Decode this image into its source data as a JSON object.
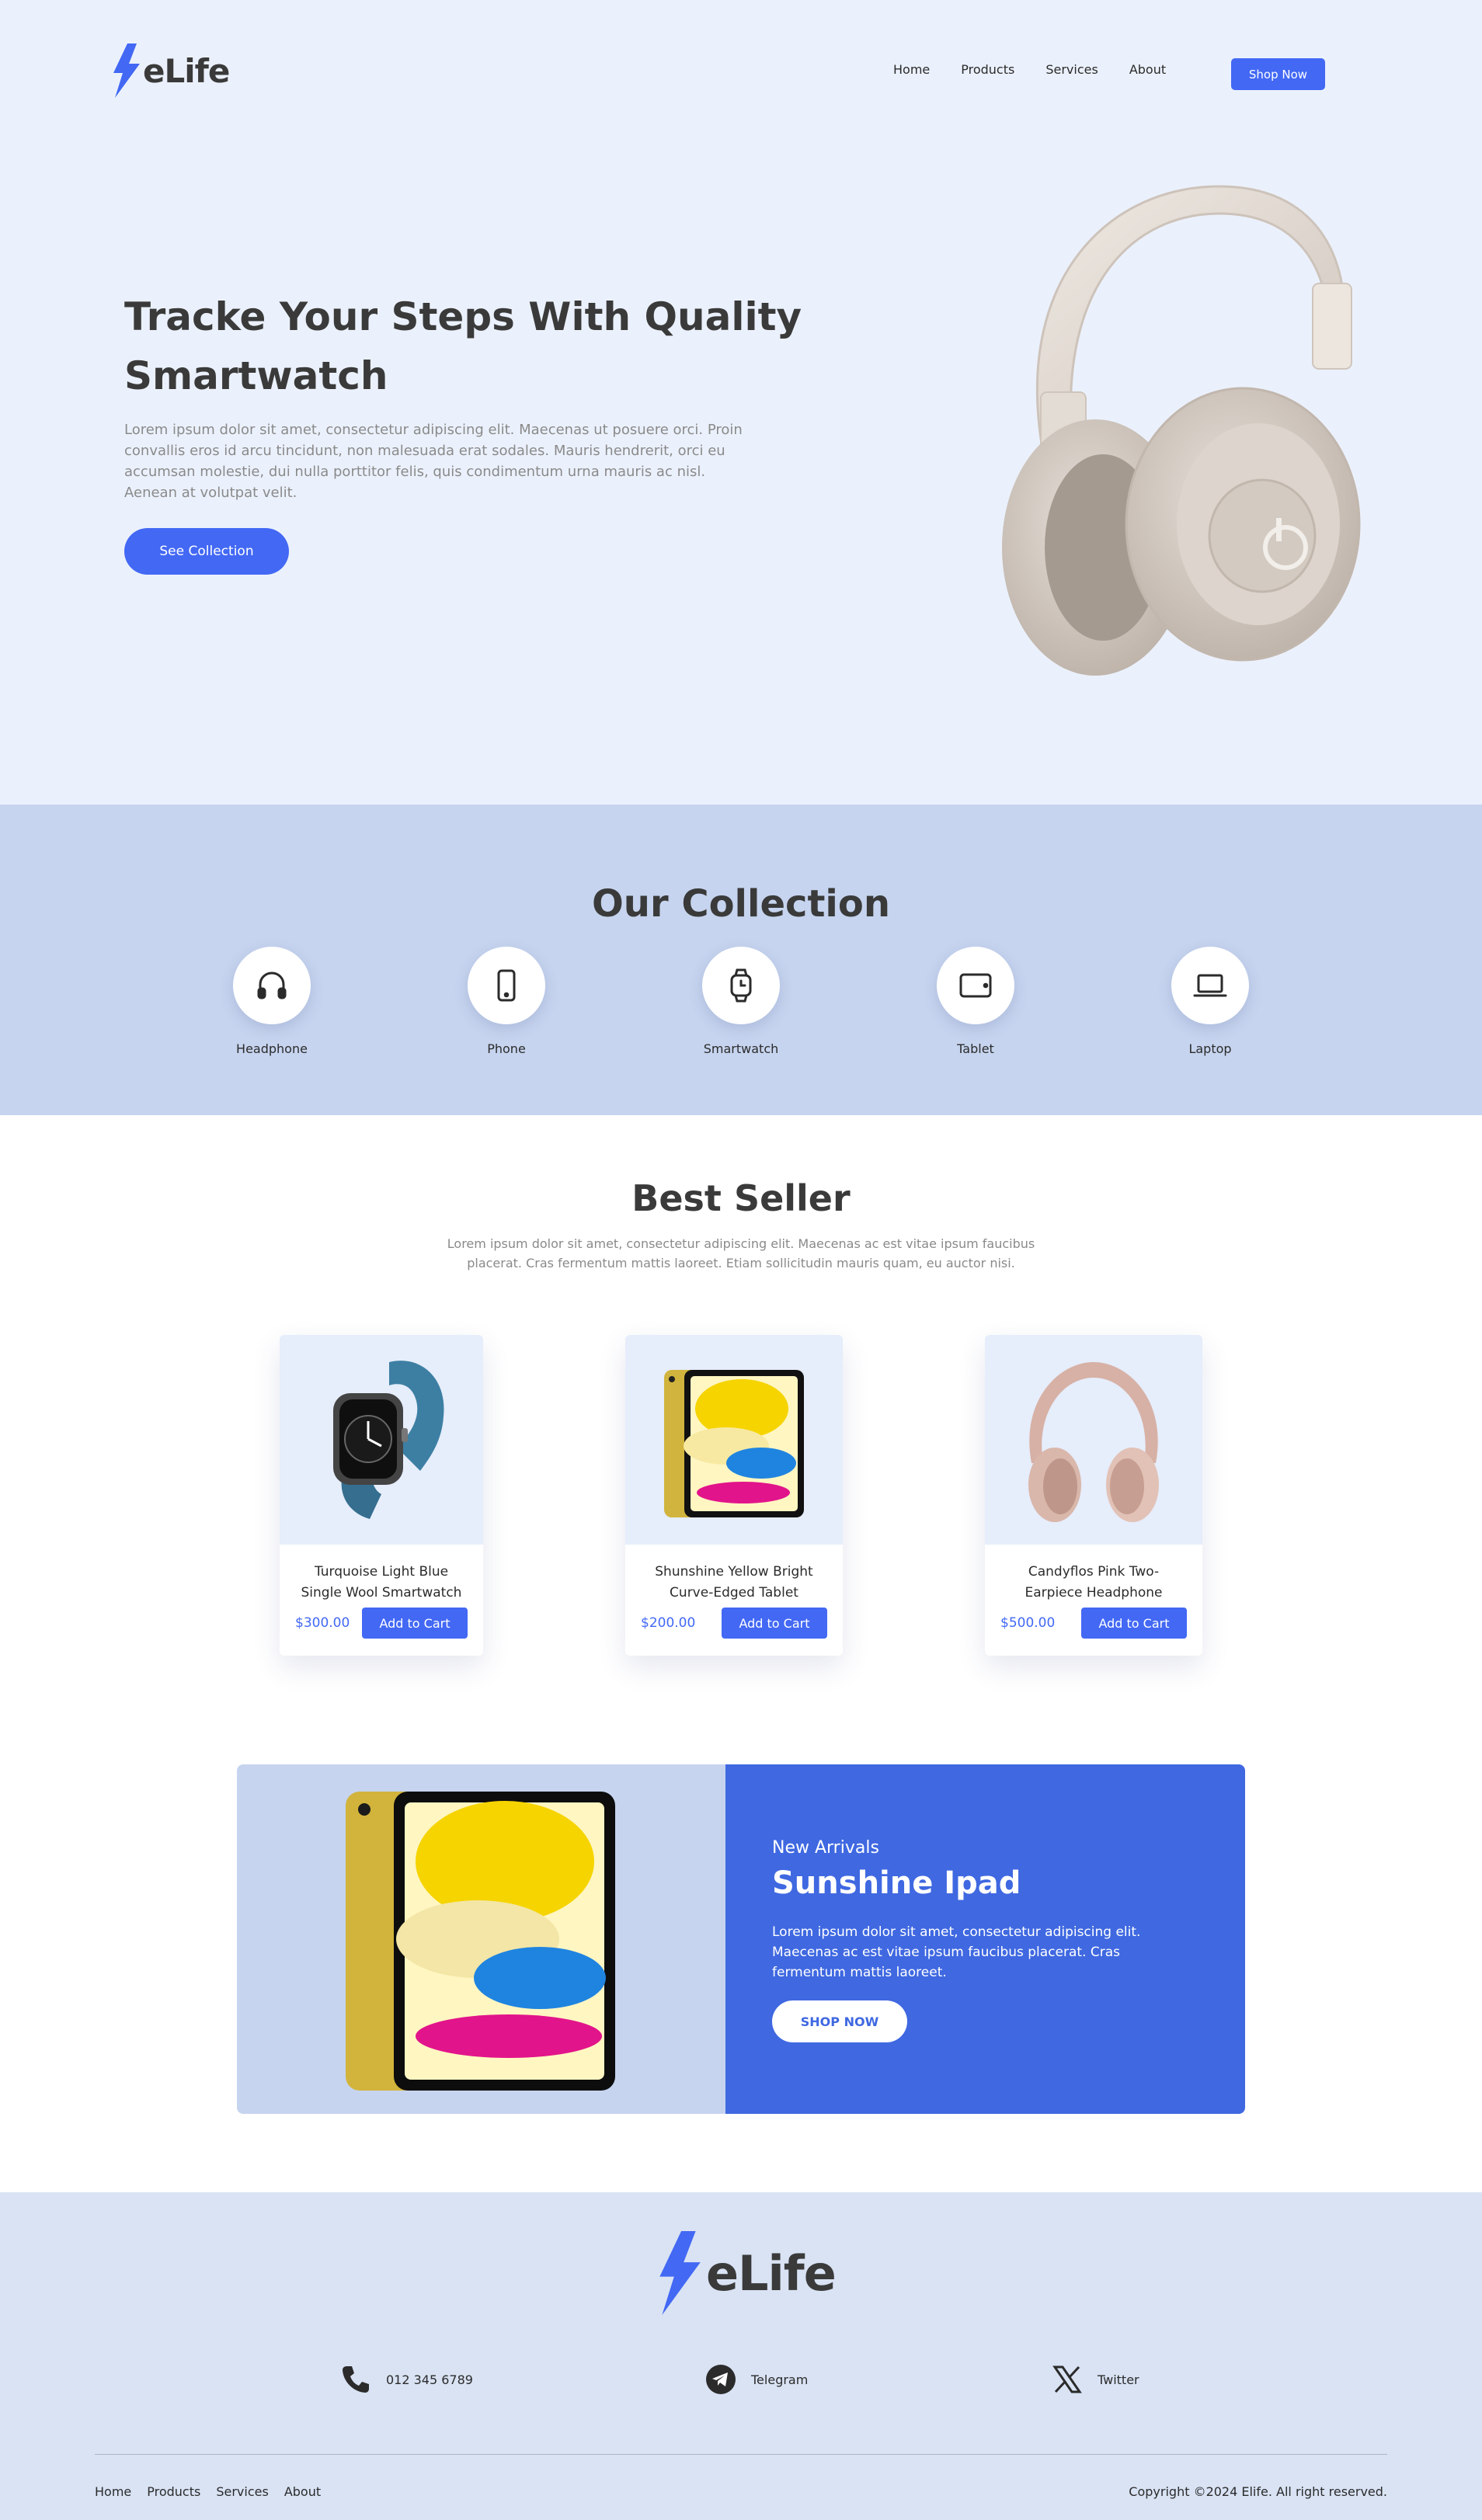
{
  "brand": {
    "name": "eLife",
    "accent": "#4268f4",
    "bolt_color": "#4268f4"
  },
  "header": {
    "nav": [
      "Home",
      "Products",
      "Services",
      "About"
    ],
    "cta": "Shop Now"
  },
  "hero": {
    "title_line1": "Tracke Your Steps With Quality",
    "title_line2": "Smartwatch",
    "desc_lines": [
      "Lorem ipsum dolor sit amet, consectetur adipiscing elit. Maecenas ut posuere orci. Proin",
      "convallis eros id arcu tincidunt, non malesuada erat sodales. Mauris hendrerit, orci eu",
      "accumsan molestie, dui nulla porttitor felis, quis condimentum urna mauris ac nisl.",
      "Aenean at volutpat velit."
    ],
    "button": "See Collection",
    "image": "headphones-image"
  },
  "collection": {
    "title": "Our Collection",
    "items": [
      {
        "label": "Headphone",
        "icon": "headphone-icon"
      },
      {
        "label": "Phone",
        "icon": "phone-icon"
      },
      {
        "label": "Smartwatch",
        "icon": "smartwatch-icon"
      },
      {
        "label": "Tablet",
        "icon": "tablet-icon"
      },
      {
        "label": "Laptop",
        "icon": "laptop-icon"
      }
    ]
  },
  "best_seller": {
    "title": "Best Seller",
    "desc_lines": [
      "Lorem ipsum dolor sit amet, consectetur adipiscing elit. Maecenas ac est vitae ipsum faucibus",
      "placerat. Cras fermentum mattis laoreet. Etiam sollicitudin mauris quam, eu auctor nisi."
    ],
    "products": [
      {
        "name_lines": [
          "Turquoise Light Blue",
          "Single Wool Smartwatch"
        ],
        "price": "$300.00",
        "button": "Add to Cart",
        "image": "smartwatch-image"
      },
      {
        "name_lines": [
          "Shunshine Yellow Bright",
          "Curve-Edged Tablet"
        ],
        "price": "$200.00",
        "button": "Add to Cart",
        "image": "tablet-image"
      },
      {
        "name_lines": [
          "Candyflos Pink Two-",
          "Earpiece Headphone"
        ],
        "price": "$500.00",
        "button": "Add to Cart",
        "image": "headphone-image"
      }
    ]
  },
  "promo": {
    "kicker": "New Arrivals",
    "title": "Sunshine Ipad",
    "desc_lines": [
      "Lorem ipsum dolor sit amet, consectetur adipiscing elit.",
      "Maecenas ac est vitae ipsum faucibus placerat. Cras",
      "fermentum mattis laoreet."
    ],
    "button": "SHOP NOW",
    "image": "ipad-image",
    "panel_color": "#3f68e1"
  },
  "footer": {
    "contacts": [
      {
        "text": "012 345 6789",
        "icon": "phone-handset-icon"
      },
      {
        "text": "Telegram",
        "icon": "telegram-icon"
      },
      {
        "text": "Twitter",
        "icon": "x-twitter-icon"
      }
    ],
    "nav": [
      "Home",
      "Products",
      "Services",
      "About"
    ],
    "copyright": "Copyright ©2024 Elife. All right reserved."
  }
}
